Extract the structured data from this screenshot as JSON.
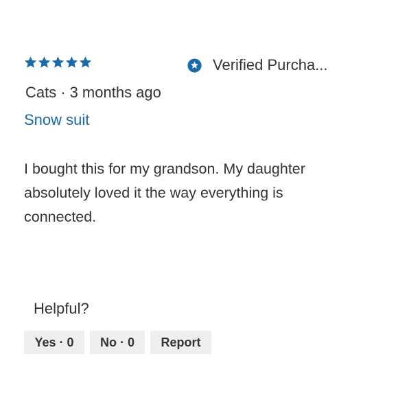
{
  "review": {
    "rating": 5,
    "rating_max": 5,
    "verified_label": "Verified Purcha...",
    "author": "Cats",
    "separator": "·",
    "time_ago": "3 months ago",
    "product_link": "Snow suit",
    "body": "I bought this for my grandson. My daughter absolutely loved it the way everything is connected."
  },
  "feedback": {
    "helpful_label": "Helpful?",
    "yes_label": "Yes",
    "yes_count": "0",
    "no_label": "No",
    "no_count": "0",
    "report_label": "Report",
    "dot": "·"
  },
  "colors": {
    "accent": "#1a6aa8",
    "text": "#333333",
    "button_bg": "#efefef"
  },
  "icons": {
    "star": "star-icon",
    "verified": "verified-badge-icon"
  }
}
